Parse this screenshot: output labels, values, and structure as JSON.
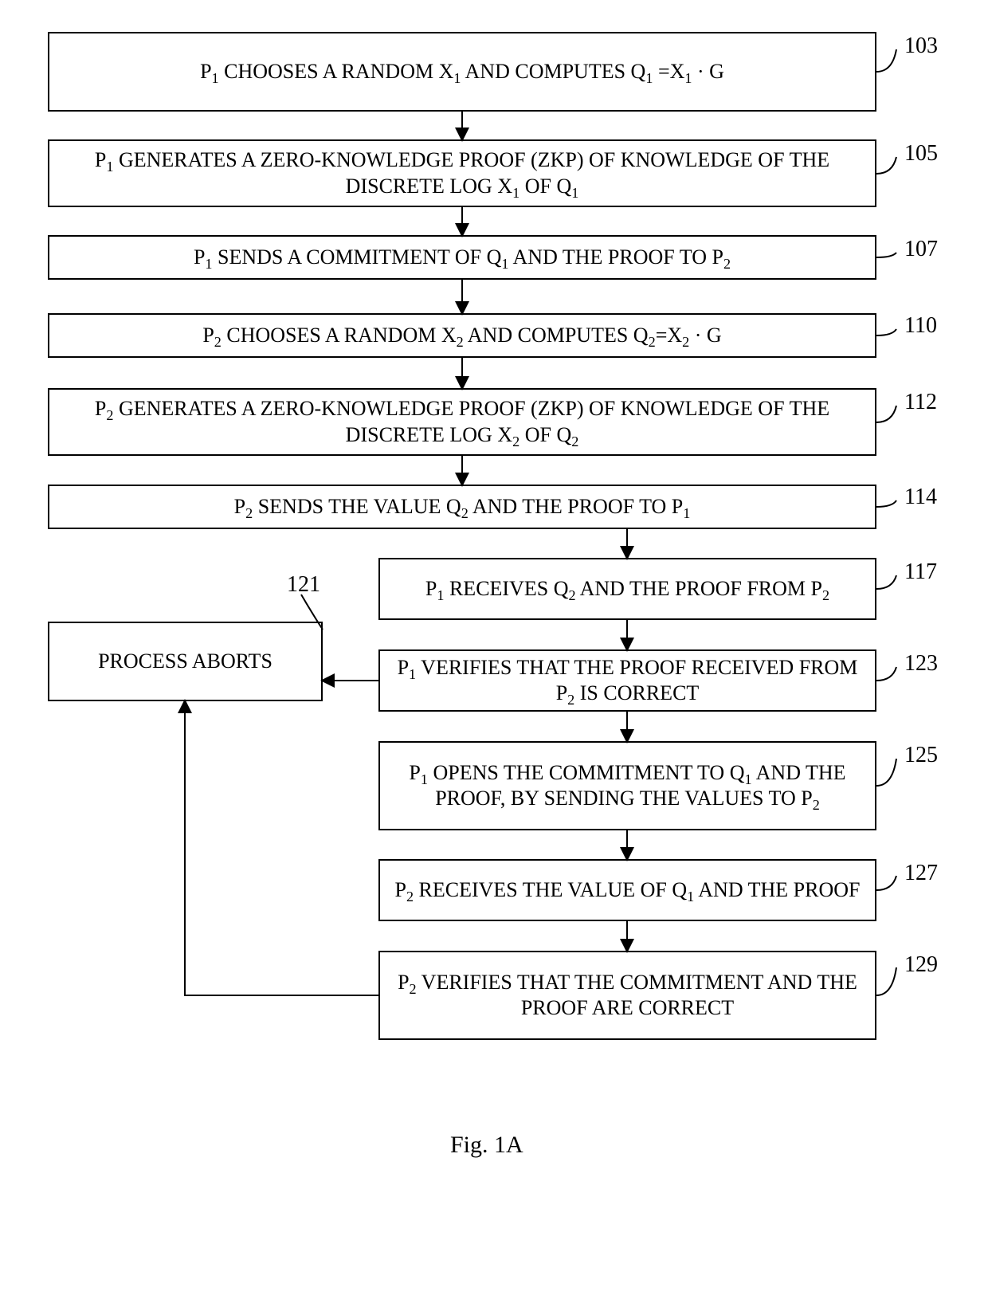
{
  "figure_label": "Fig. 1A",
  "steps": {
    "s103": {
      "ref": "103",
      "text": "P<sub>1</sub> CHOOSES A RANDOM X<sub>1</sub> AND COMPUTES Q<sub>1</sub> =X<sub>1</sub> · G"
    },
    "s105": {
      "ref": "105",
      "text": "P<sub>1</sub> GENERATES A ZERO-KNOWLEDGE PROOF (ZKP) OF KNOWLEDGE OF THE DISCRETE LOG X<sub>1</sub> OF Q<sub>1</sub>"
    },
    "s107": {
      "ref": "107",
      "text": "P<sub>1</sub> SENDS A COMMITMENT OF Q<sub>1</sub> AND THE PROOF TO P<sub>2</sub>"
    },
    "s110": {
      "ref": "110",
      "text": "P<sub>2</sub> CHOOSES A RANDOM X<sub>2</sub> AND COMPUTES Q<sub>2</sub>=X<sub>2</sub> · G"
    },
    "s112": {
      "ref": "112",
      "text": "P<sub>2</sub> GENERATES A ZERO-KNOWLEDGE PROOF (ZKP) OF KNOWLEDGE OF THE DISCRETE LOG X<sub>2</sub> OF Q<sub>2</sub>"
    },
    "s114": {
      "ref": "114",
      "text": "P<sub>2</sub> SENDS THE VALUE Q<sub>2</sub> AND THE PROOF TO P<sub>1</sub>"
    },
    "s117": {
      "ref": "117",
      "text": "P<sub>1</sub> RECEIVES Q<sub>2</sub> AND THE PROOF FROM P<sub>2</sub>"
    },
    "s123": {
      "ref": "123",
      "text": "P<sub>1</sub> VERIFIES THAT THE PROOF RECEIVED FROM P<sub>2</sub> IS CORRECT"
    },
    "s125": {
      "ref": "125",
      "text": "P<sub>1</sub> OPENS THE COMMITMENT TO Q<sub>1</sub> AND THE PROOF, BY SENDING THE VALUES TO P<sub>2</sub>"
    },
    "s127": {
      "ref": "127",
      "text": "P<sub>2</sub> RECEIVES THE VALUE OF Q<sub>1</sub> AND THE PROOF"
    },
    "s129": {
      "ref": "129",
      "text": "P<sub>2</sub> VERIFIES THAT THE COMMITMENT AND THE PROOF ARE CORRECT"
    },
    "abort": {
      "ref": "121",
      "text": "PROCESS ABORTS"
    }
  }
}
